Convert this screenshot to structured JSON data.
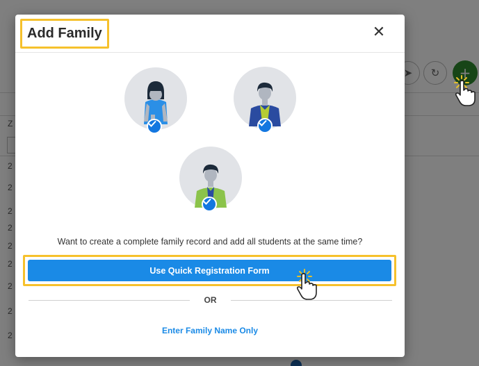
{
  "modal": {
    "title": "Add Family",
    "close_icon": "close-icon",
    "prompt": "Want to create a complete family record and add all students at the same time?",
    "quick_button_label": "Use Quick Registration Form",
    "or_label": "OR",
    "name_only_label": "Enter Family Name Only",
    "avatars": [
      "female-guardian-avatar",
      "male-guardian-avatar",
      "student-avatar"
    ]
  },
  "background": {
    "toolbar_icons": [
      "send-icon",
      "refresh-icon",
      "plus-icon"
    ],
    "row_edge_text": [
      "Z",
      "2",
      "2",
      "2",
      "2",
      "2",
      "2",
      "2",
      "2",
      "2"
    ]
  },
  "colors": {
    "accent": "#1a8ae6",
    "highlight": "#f6c12c",
    "check": "#1377e0",
    "add_button": "#2e8b2e"
  }
}
